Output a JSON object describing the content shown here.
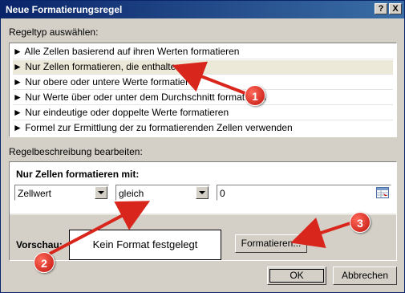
{
  "window": {
    "title": "Neue Formatierungsregel"
  },
  "titlebar_buttons": {
    "help": "?",
    "close": "X"
  },
  "rule_type": {
    "label": "Regeltyp auswählen:",
    "items": [
      "► Alle Zellen basierend auf ihren Werten formatieren",
      "► Nur Zellen formatieren, die enthalten",
      "► Nur obere oder untere Werte formatieren",
      "► Nur Werte über oder unter dem Durchschnitt formatieren",
      "► Nur eindeutige oder doppelte Werte formatieren",
      "► Formel zur Ermittlung der zu formatierenden Zellen verwenden"
    ],
    "selected_index": 1
  },
  "rule_description": {
    "label": "Regelbeschreibung bearbeiten:",
    "heading": "Nur Zellen formatieren mit:",
    "condition_type": "Zellwert",
    "operator": "gleich",
    "value": "0",
    "preview_label": "Vorschau:",
    "preview_text": "Kein Format festgelegt",
    "format_button": "Formatieren..."
  },
  "dialog_buttons": {
    "ok": "OK",
    "cancel": "Abbrechen"
  },
  "annotations": [
    "1",
    "2",
    "3"
  ],
  "colors": {
    "titlebar": "#0a246a",
    "annotation": "#d9261c",
    "dialog": "#d4d0c8"
  }
}
